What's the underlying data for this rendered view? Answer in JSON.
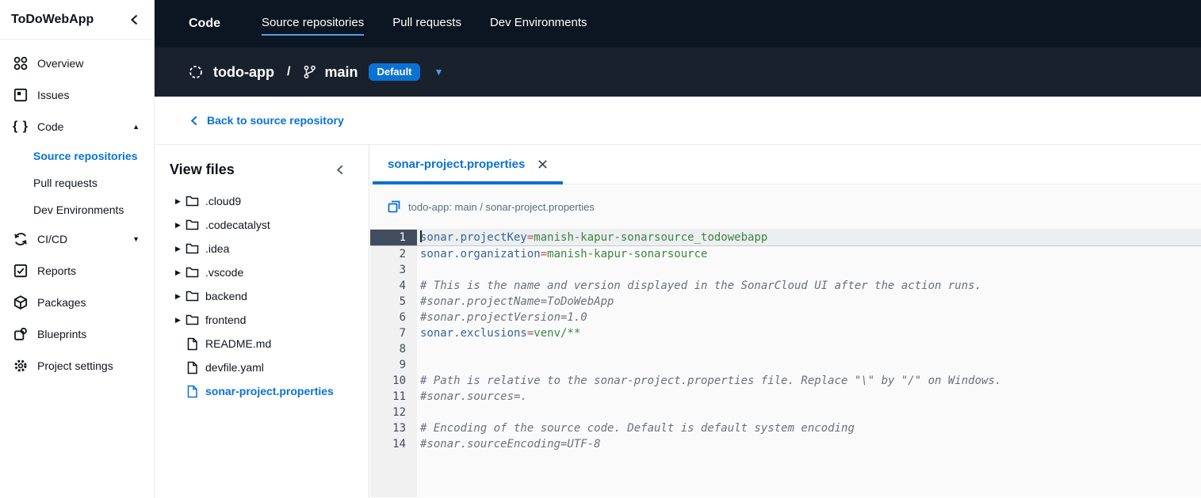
{
  "colors": {
    "accent_blue": "#0972d3",
    "tab_underline_blue": "#539fe5",
    "topbar_bg": "#0c1522",
    "repobar_bg": "#19212d",
    "token_key": "#35659a",
    "token_equals": "#b0544e",
    "token_value": "#3c8442",
    "token_comment": "#6b707b",
    "active_line_gutter": "#414d5c"
  },
  "sidebar": {
    "title": "ToDoWebApp",
    "items": [
      {
        "id": "overview",
        "label": "Overview",
        "icon": "overview-icon",
        "type": "top"
      },
      {
        "id": "issues",
        "label": "Issues",
        "icon": "issues-icon",
        "type": "top"
      },
      {
        "id": "code",
        "label": "Code",
        "icon": "code-icon",
        "type": "top",
        "caret": "up"
      },
      {
        "id": "source-repositories",
        "label": "Source repositories",
        "type": "sub",
        "active": true
      },
      {
        "id": "pull-requests",
        "label": "Pull requests",
        "type": "sub"
      },
      {
        "id": "dev-environments",
        "label": "Dev Environments",
        "type": "sub"
      },
      {
        "id": "cicd",
        "label": "CI/CD",
        "icon": "cicd-icon",
        "type": "top",
        "caret": "down"
      },
      {
        "id": "reports",
        "label": "Reports",
        "icon": "reports-icon",
        "type": "top"
      },
      {
        "id": "packages",
        "label": "Packages",
        "icon": "packages-icon",
        "type": "top"
      },
      {
        "id": "blueprints",
        "label": "Blueprints",
        "icon": "blueprints-icon",
        "type": "top"
      },
      {
        "id": "project-settings",
        "label": "Project settings",
        "icon": "settings-icon",
        "type": "top"
      }
    ]
  },
  "topnav": {
    "service": "Code",
    "tabs": [
      {
        "label": "Source repositories",
        "active": true
      },
      {
        "label": "Pull requests",
        "active": false
      },
      {
        "label": "Dev Environments",
        "active": false
      }
    ]
  },
  "repobar": {
    "repo": "todo-app",
    "separator": "/",
    "branch": "main",
    "badge": "Default"
  },
  "back_link": "Back to source repository",
  "files_panel": {
    "title": "View files",
    "tree": [
      {
        "name": ".cloud9",
        "kind": "folder"
      },
      {
        "name": ".codecatalyst",
        "kind": "folder"
      },
      {
        "name": ".idea",
        "kind": "folder"
      },
      {
        "name": ".vscode",
        "kind": "folder"
      },
      {
        "name": "backend",
        "kind": "folder"
      },
      {
        "name": "frontend",
        "kind": "folder"
      },
      {
        "name": "README.md",
        "kind": "file"
      },
      {
        "name": "devfile.yaml",
        "kind": "file"
      },
      {
        "name": "sonar-project.properties",
        "kind": "file",
        "selected": true
      }
    ]
  },
  "editor": {
    "tab_label": "sonar-project.properties",
    "breadcrumb": "todo-app: main / sonar-project.properties",
    "lines": [
      {
        "n": 1,
        "active": true,
        "segs": [
          {
            "t": "key",
            "v": "sonar.projectKey"
          },
          {
            "t": "eq",
            "v": "="
          },
          {
            "t": "val",
            "v": "manish-kapur-sonarsource_todowebapp"
          }
        ]
      },
      {
        "n": 2,
        "segs": [
          {
            "t": "key",
            "v": "sonar.organization"
          },
          {
            "t": "eq",
            "v": "="
          },
          {
            "t": "val",
            "v": "manish-kapur-sonarsource"
          }
        ]
      },
      {
        "n": 3,
        "segs": []
      },
      {
        "n": 4,
        "segs": [
          {
            "t": "com",
            "v": "# This is the name and version displayed in the SonarCloud UI after the action runs."
          }
        ]
      },
      {
        "n": 5,
        "segs": [
          {
            "t": "com",
            "v": "#sonar.projectName=ToDoWebApp"
          }
        ]
      },
      {
        "n": 6,
        "segs": [
          {
            "t": "com",
            "v": "#sonar.projectVersion=1.0"
          }
        ]
      },
      {
        "n": 7,
        "segs": [
          {
            "t": "key",
            "v": "sonar.exclusions"
          },
          {
            "t": "eq",
            "v": "="
          },
          {
            "t": "val",
            "v": "venv/**"
          }
        ]
      },
      {
        "n": 8,
        "segs": []
      },
      {
        "n": 9,
        "segs": []
      },
      {
        "n": 10,
        "segs": [
          {
            "t": "com",
            "v": "# Path is relative to the sonar-project.properties file. Replace \"\\\" by \"/\" on Windows."
          }
        ]
      },
      {
        "n": 11,
        "segs": [
          {
            "t": "com",
            "v": "#sonar.sources=."
          }
        ]
      },
      {
        "n": 12,
        "segs": []
      },
      {
        "n": 13,
        "segs": [
          {
            "t": "com",
            "v": "# Encoding of the source code. Default is default system encoding"
          }
        ]
      },
      {
        "n": 14,
        "segs": [
          {
            "t": "com",
            "v": "#sonar.sourceEncoding=UTF-8"
          }
        ]
      }
    ]
  }
}
